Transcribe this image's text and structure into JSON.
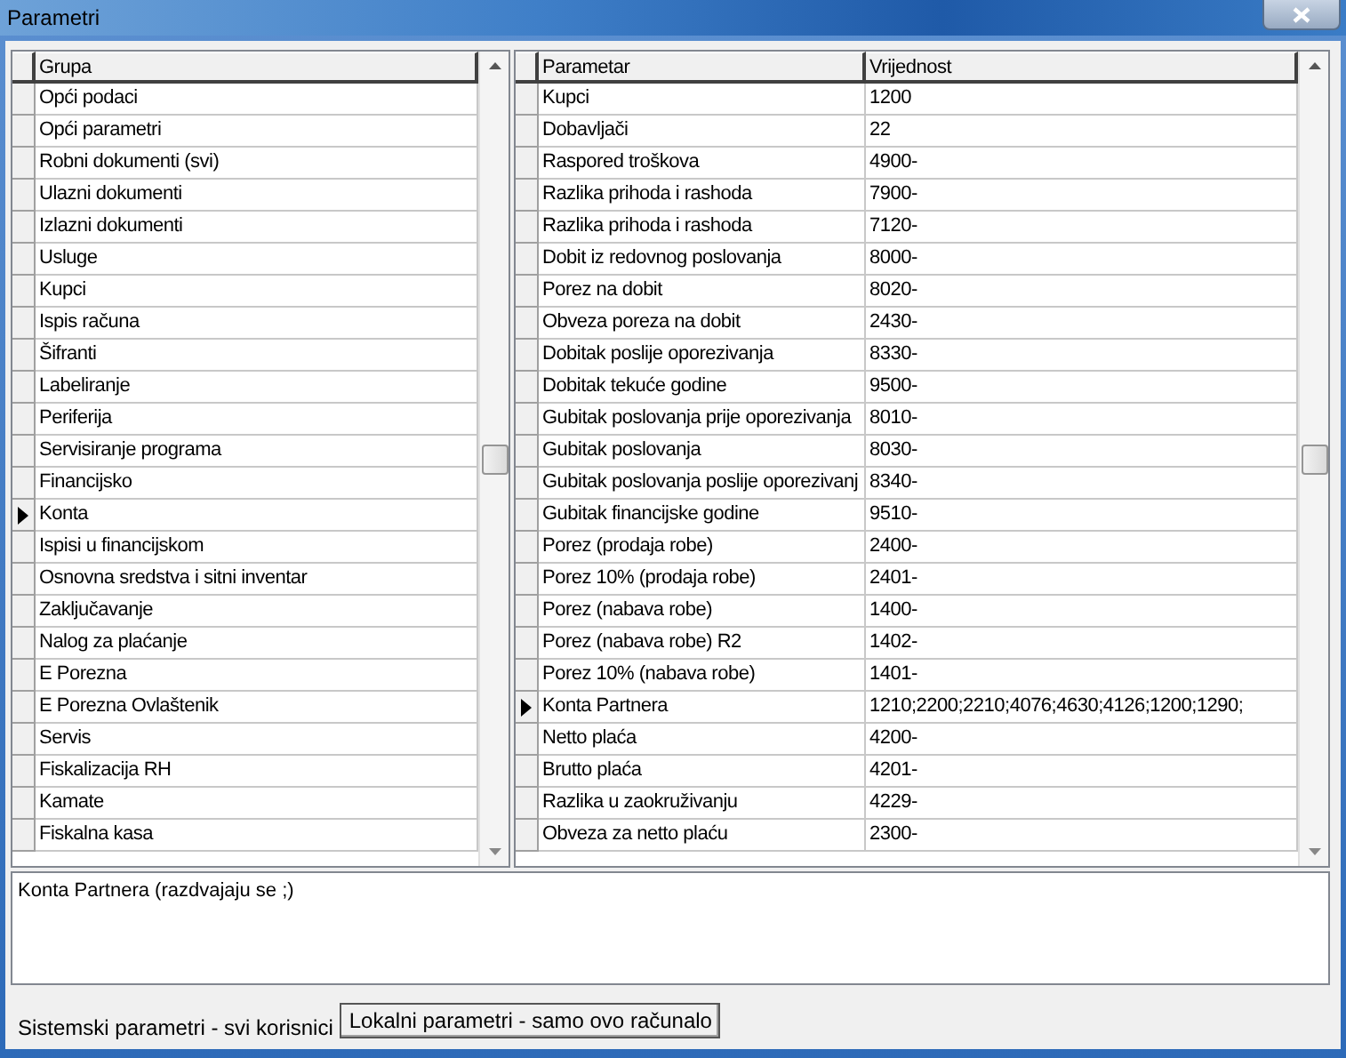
{
  "window": {
    "title": "Parametri"
  },
  "groups": {
    "columns": [
      "Grupa"
    ],
    "rows": [
      {
        "name": "Opći podaci",
        "selected": false
      },
      {
        "name": "Opći parametri",
        "selected": false
      },
      {
        "name": "Robni dokumenti (svi)",
        "selected": false
      },
      {
        "name": "Ulazni dokumenti",
        "selected": false
      },
      {
        "name": "Izlazni dokumenti",
        "selected": false
      },
      {
        "name": "Usluge",
        "selected": false
      },
      {
        "name": "Kupci",
        "selected": false
      },
      {
        "name": "Ispis računa",
        "selected": false
      },
      {
        "name": "Šifranti",
        "selected": false
      },
      {
        "name": "Labeliranje",
        "selected": false
      },
      {
        "name": "Periferija",
        "selected": false
      },
      {
        "name": "Servisiranje programa",
        "selected": false
      },
      {
        "name": "Financijsko",
        "selected": false
      },
      {
        "name": "Konta",
        "selected": true
      },
      {
        "name": "Ispisi u financijskom",
        "selected": false
      },
      {
        "name": "Osnovna sredstva i sitni inventar",
        "selected": false
      },
      {
        "name": "Zaključavanje",
        "selected": false
      },
      {
        "name": "Nalog za plaćanje",
        "selected": false
      },
      {
        "name": "E Porezna",
        "selected": false
      },
      {
        "name": "E Porezna Ovlaštenik",
        "selected": false
      },
      {
        "name": "Servis",
        "selected": false
      },
      {
        "name": "Fiskalizacija RH",
        "selected": false
      },
      {
        "name": "Kamate",
        "selected": false
      },
      {
        "name": "Fiskalna kasa",
        "selected": false
      }
    ]
  },
  "parameters": {
    "columns": [
      "Parametar",
      "Vrijednost"
    ],
    "rows": [
      {
        "name": "Kupci",
        "value": "1200",
        "selected": false
      },
      {
        "name": "Dobavljači",
        "value": "22",
        "selected": false
      },
      {
        "name": "Raspored troškova",
        "value": "4900-",
        "selected": false
      },
      {
        "name": "Razlika prihoda i rashoda",
        "value": "7900-",
        "selected": false
      },
      {
        "name": "Razlika prihoda i rashoda",
        "value": "7120-",
        "selected": false
      },
      {
        "name": "Dobit iz redovnog poslovanja",
        "value": "8000-",
        "selected": false
      },
      {
        "name": "Porez na dobit",
        "value": "8020-",
        "selected": false
      },
      {
        "name": "Obveza poreza na dobit",
        "value": "2430-",
        "selected": false
      },
      {
        "name": "Dobitak poslije oporezivanja",
        "value": "8330-",
        "selected": false
      },
      {
        "name": "Dobitak tekuće godine",
        "value": "9500-",
        "selected": false
      },
      {
        "name": "Gubitak poslovanja prije oporezivanja",
        "value": "8010-",
        "selected": false
      },
      {
        "name": "Gubitak poslovanja",
        "value": "8030-",
        "selected": false
      },
      {
        "name": "Gubitak poslovanja poslije oporezivanj",
        "value": "8340-",
        "selected": false
      },
      {
        "name": "Gubitak financijske godine",
        "value": "9510-",
        "selected": false
      },
      {
        "name": "Porez (prodaja robe)",
        "value": "2400-",
        "selected": false
      },
      {
        "name": "Porez 10% (prodaja robe)",
        "value": "2401-",
        "selected": false
      },
      {
        "name": "Porez (nabava robe)",
        "value": "1400-",
        "selected": false
      },
      {
        "name": "Porez (nabava robe) R2",
        "value": "1402-",
        "selected": false
      },
      {
        "name": "Porez 10% (nabava robe)",
        "value": "1401-",
        "selected": false
      },
      {
        "name": "Konta Partnera",
        "value": "1210;2200;2210;4076;4630;4126;1200;1290;",
        "selected": true
      },
      {
        "name": "Netto plaća",
        "value": "4200-",
        "selected": false
      },
      {
        "name": "Brutto plaća",
        "value": "4201-",
        "selected": false
      },
      {
        "name": "Razlika u zaokruživanju",
        "value": "4229-",
        "selected": false
      },
      {
        "name": "Obveza za netto plaću",
        "value": "2300-",
        "selected": false
      }
    ]
  },
  "description": "Konta Partnera (razdvajaju se ;)",
  "tabs": [
    {
      "label": "Sistemski parametri - svi korisnici",
      "selected": true
    },
    {
      "label": "Lokalni parametri - samo ovo računalo",
      "selected": false
    }
  ]
}
